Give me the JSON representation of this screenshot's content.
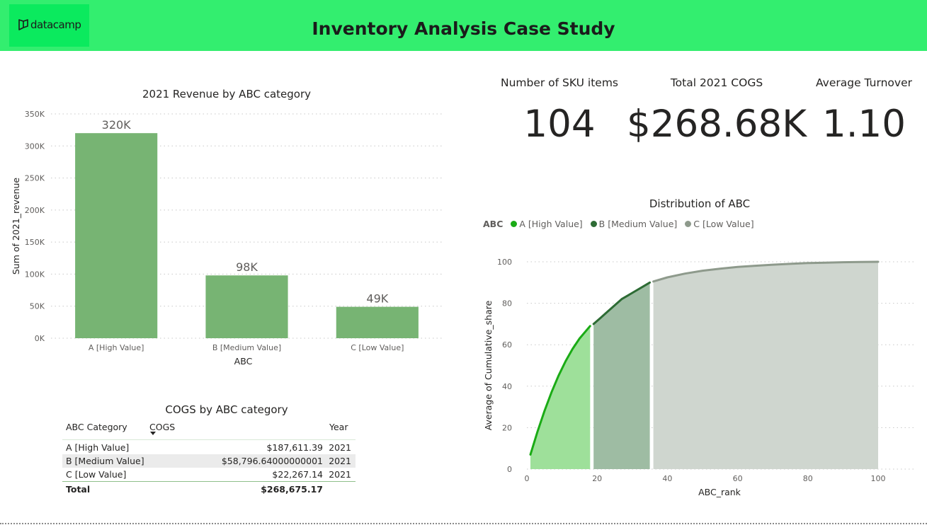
{
  "header": {
    "logo_text": "datacamp",
    "title": "Inventory Analysis Case Study",
    "background_color": "#33ee6f"
  },
  "kpis": [
    {
      "label": "Number of SKU items",
      "value": "104"
    },
    {
      "label": "Total 2021 COGS",
      "value": "$268.68K"
    },
    {
      "label": "Average Turnover",
      "value": "1.10"
    }
  ],
  "chart_data": [
    {
      "type": "bar",
      "title": "2021 Revenue by ABC category",
      "xlabel": "ABC",
      "ylabel": "Sum of 2021_revenue",
      "categories": [
        "A [High Value]",
        "B [Medium Value]",
        "C [Low Value]"
      ],
      "values": [
        320000,
        98000,
        49000
      ],
      "data_labels": [
        "320K",
        "98K",
        "49K"
      ],
      "ylim": [
        0,
        350000
      ],
      "yticks": [
        0,
        50000,
        100000,
        150000,
        200000,
        250000,
        300000,
        350000
      ],
      "ytick_labels": [
        "0K",
        "50K",
        "100K",
        "150K",
        "200K",
        "250K",
        "300K",
        "350K"
      ],
      "grid": true,
      "color": "#77b473"
    },
    {
      "type": "area",
      "title": "Distribution of ABC",
      "xlabel": "ABC_rank",
      "ylabel": "Average of Cumulative_share",
      "legend_title": "ABC",
      "legend_position": "top-left",
      "xlim": [
        0,
        100
      ],
      "ylim": [
        0,
        100
      ],
      "xticks": [
        0,
        20,
        40,
        60,
        80,
        100
      ],
      "yticks": [
        0,
        20,
        40,
        60,
        80,
        100
      ],
      "grid": true,
      "series": [
        {
          "name": "A [High Value]",
          "color": "#1aab15",
          "fill": "#9ee09a",
          "x": [
            1,
            3,
            5,
            7,
            9,
            11,
            13,
            15,
            17,
            18
          ],
          "y": [
            7,
            18,
            28,
            37,
            45,
            52,
            58,
            63,
            67,
            69
          ]
        },
        {
          "name": "B [Medium Value]",
          "color": "#2d6b34",
          "fill": "#9ebca3",
          "x": [
            19,
            21,
            23,
            25,
            27,
            29,
            31,
            33,
            35
          ],
          "y": [
            70,
            73,
            76,
            79,
            82,
            84,
            86,
            88,
            90
          ]
        },
        {
          "name": "C [Low Value]",
          "color": "#8e9a8c",
          "fill": "#cfd6cf",
          "x": [
            36,
            40,
            45,
            50,
            55,
            60,
            65,
            70,
            75,
            80,
            85,
            90,
            95,
            100
          ],
          "y": [
            90.5,
            92.5,
            94.3,
            95.7,
            96.7,
            97.5,
            98.1,
            98.6,
            99.0,
            99.4,
            99.6,
            99.8,
            99.9,
            100
          ]
        }
      ]
    }
  ],
  "cogs_table": {
    "title": "COGS by ABC category",
    "columns": [
      "ABC Category",
      "COGS",
      "Year"
    ],
    "rows": [
      {
        "category": "A [High Value]",
        "cogs": "$187,611.39",
        "year": "2021"
      },
      {
        "category": "B [Medium Value]",
        "cogs": "$58,796.64000000001",
        "year": "2021"
      },
      {
        "category": "C [Low Value]",
        "cogs": "$22,267.14",
        "year": "2021"
      }
    ],
    "total": {
      "label": "Total",
      "cogs": "$268,675.17"
    }
  }
}
